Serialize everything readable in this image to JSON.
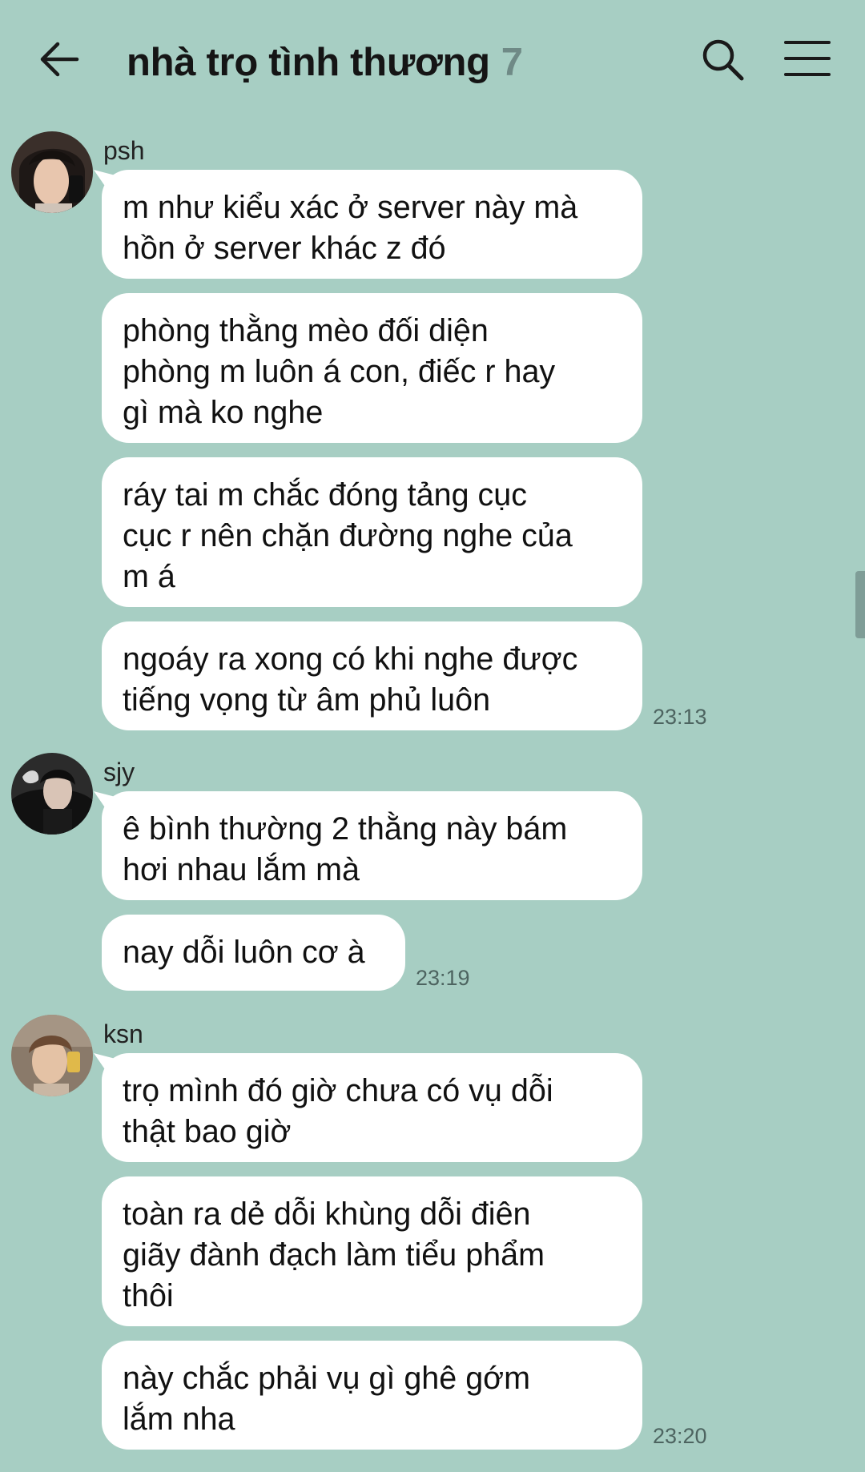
{
  "header": {
    "title": "nhà trọ tình thương",
    "member_count": "7",
    "back_icon": "arrow-left-icon",
    "search_icon": "search-icon",
    "menu_icon": "hamburger-menu-icon"
  },
  "colors": {
    "background": "#a7cec3",
    "bubble": "#ffffff",
    "member_count": "#6f8a86",
    "timestamp": "#4d6460"
  },
  "groups": [
    {
      "sender": "psh",
      "avatar_icon": "avatar-psh",
      "messages": [
        "m như kiểu xác ở server này mà\nhồn ở server khác z đó",
        "phòng thằng mèo đối diện\nphòng m luôn á con, điếc r hay\ngì mà ko nghe",
        "ráy tai m chắc đóng tảng cục\ncục r nên chặn đường nghe của\nm á",
        "ngoáy ra xong có khi nghe được\ntiếng vọng từ âm phủ luôn"
      ],
      "time": "23:13"
    },
    {
      "sender": "sjy",
      "avatar_icon": "avatar-sjy",
      "messages": [
        "ê bình thường 2 thằng này bám\nhơi nhau lắm mà",
        "nay dỗi luôn cơ à"
      ],
      "time": "23:19"
    },
    {
      "sender": "ksn",
      "avatar_icon": "avatar-ksn",
      "messages": [
        "trọ mình đó giờ chưa có vụ dỗi\nthật bao giờ",
        "toàn ra dẻ dỗi khùng dỗi điên\ngiãy đành đạch làm tiểu phẩm\nthôi",
        "này chắc phải vụ gì ghê gớm\nlắm nha"
      ],
      "time": "23:20"
    }
  ]
}
